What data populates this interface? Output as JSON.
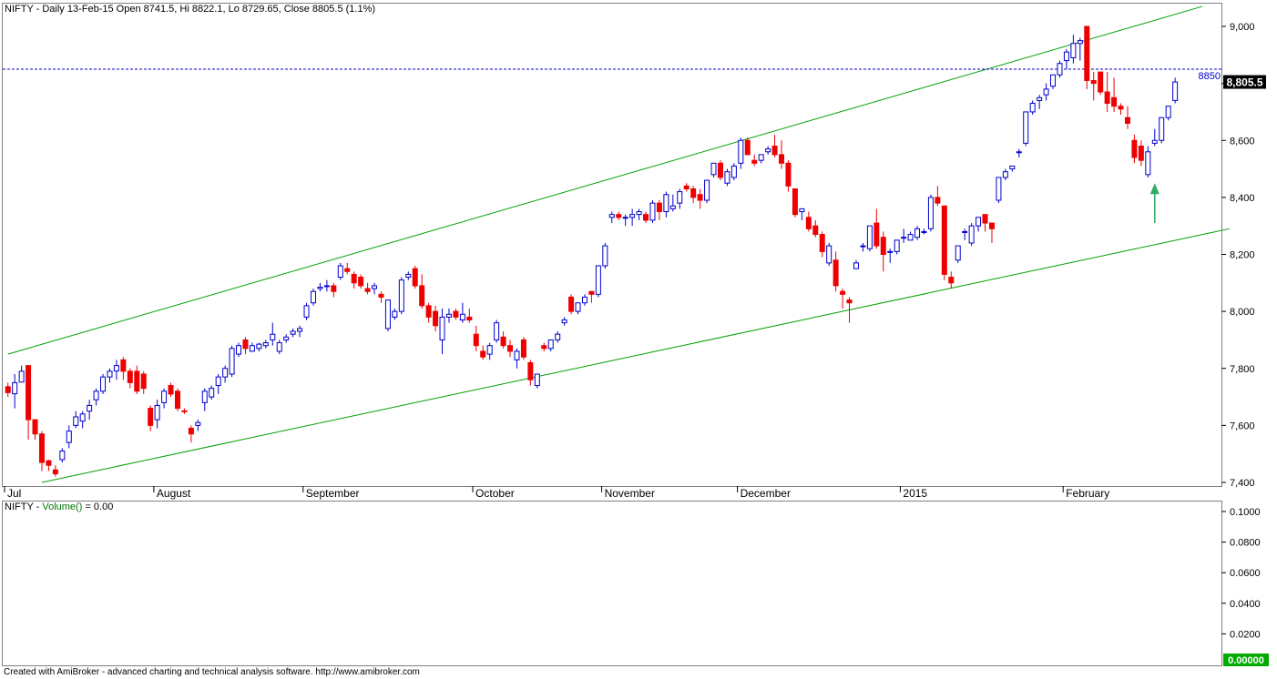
{
  "price_panel": {
    "header": "NIFTY - Daily 13-Feb-15 Open 8741.5, Hi 8822.1, Lo 8729.65, Close 8805.5 (1.1%)",
    "last_price_label": "8,805.5",
    "ref_line_label": "8850"
  },
  "volume_panel": {
    "header_prefix": "NIFTY - ",
    "header_indicator": "Volume()",
    "header_suffix": " = 0.00",
    "last_value_label": "0.00000"
  },
  "footer": "Created with AmiBroker - advanced charting and technical analysis software. http://www.amibroker.com",
  "colors": {
    "up_body": "#ffffff",
    "up_border": "#0000cc",
    "down_body": "#ee0000",
    "channel": "#00a000",
    "ref_line": "#0000cc",
    "arrow": "#33aa66",
    "volume_label": "#007700",
    "last_price_bg": "#000000",
    "last_volume_bg": "#00aa00"
  },
  "chart_data": [
    {
      "type": "candlestick",
      "name": "NIFTY",
      "x_labels": [
        "Jul",
        "August",
        "September",
        "October",
        "November",
        "December",
        "2015",
        "February"
      ],
      "y_ticks": [
        "7,400",
        "7,600",
        "7,800",
        "8,000",
        "8,200",
        "8,400",
        "8,600",
        "8,800",
        "9,000"
      ],
      "ylim": [
        7400,
        9000
      ],
      "reference_line": 8850,
      "channel_upper": [
        [
          0,
          7850
        ],
        [
          176,
          9070
        ]
      ],
      "channel_lower": [
        [
          5,
          7400
        ],
        [
          180,
          8290
        ]
      ],
      "annotation": {
        "type": "up-arrow",
        "at_bar": 169,
        "price_from": 8310,
        "price_to": 8450
      },
      "candles": [
        [
          7736,
          7750,
          7700,
          7715
        ],
        [
          7711,
          7780,
          7660,
          7750
        ],
        [
          7752,
          7810,
          7760,
          7790
        ],
        [
          7810,
          7810,
          7550,
          7620
        ],
        [
          7620,
          7620,
          7550,
          7570
        ],
        [
          7570,
          7580,
          7440,
          7470
        ],
        [
          7476,
          7480,
          7440,
          7460
        ],
        [
          7444,
          7460,
          7420,
          7430
        ],
        [
          7480,
          7520,
          7470,
          7510
        ],
        [
          7540,
          7600,
          7520,
          7580
        ],
        [
          7600,
          7650,
          7590,
          7630
        ],
        [
          7615,
          7650,
          7590,
          7640
        ],
        [
          7650,
          7690,
          7620,
          7670
        ],
        [
          7690,
          7730,
          7670,
          7720
        ],
        [
          7720,
          7780,
          7710,
          7770
        ],
        [
          7770,
          7800,
          7750,
          7790
        ],
        [
          7791,
          7830,
          7760,
          7810
        ],
        [
          7830,
          7840,
          7760,
          7790
        ],
        [
          7790,
          7800,
          7730,
          7750
        ],
        [
          7790,
          7810,
          7710,
          7720
        ],
        [
          7780,
          7790,
          7710,
          7730
        ],
        [
          7660,
          7670,
          7580,
          7600
        ],
        [
          7620,
          7690,
          7590,
          7670
        ],
        [
          7680,
          7730,
          7660,
          7720
        ],
        [
          7740,
          7750,
          7700,
          7710
        ],
        [
          7720,
          7730,
          7650,
          7660
        ],
        [
          7651,
          7660,
          7640,
          7649
        ],
        [
          7590,
          7600,
          7540,
          7570
        ],
        [
          7600,
          7620,
          7580,
          7610
        ],
        [
          7680,
          7730,
          7650,
          7720
        ],
        [
          7700,
          7740,
          7690,
          7730
        ],
        [
          7740,
          7780,
          7710,
          7770
        ],
        [
          7770,
          7810,
          7750,
          7800
        ],
        [
          7780,
          7880,
          7770,
          7870
        ],
        [
          7850,
          7890,
          7840,
          7880
        ],
        [
          7900,
          7910,
          7850,
          7870
        ],
        [
          7860,
          7890,
          7860,
          7880
        ],
        [
          7870,
          7890,
          7860,
          7885
        ],
        [
          7880,
          7900,
          7870,
          7890
        ],
        [
          7900,
          7960,
          7880,
          7920
        ],
        [
          7860,
          7900,
          7850,
          7890
        ],
        [
          7900,
          7920,
          7890,
          7910
        ],
        [
          7920,
          7940,
          7910,
          7930
        ],
        [
          7930,
          7950,
          7910,
          7940
        ],
        [
          7980,
          8030,
          7970,
          8020
        ],
        [
          8030,
          8080,
          8020,
          8070
        ],
        [
          8080,
          8100,
          8070,
          8085
        ],
        [
          8090,
          8110,
          8070,
          8090
        ],
        [
          8090,
          8100,
          8050,
          8070
        ],
        [
          8120,
          8170,
          8110,
          8160
        ],
        [
          8150,
          8170,
          8130,
          8140
        ],
        [
          8130,
          8140,
          8080,
          8100
        ],
        [
          8120,
          8130,
          8080,
          8090
        ],
        [
          8080,
          8100,
          8060,
          8070
        ],
        [
          8080,
          8100,
          8060,
          8090
        ],
        [
          8060,
          8070,
          8030,
          8050
        ],
        [
          7940,
          8030,
          7930,
          8040
        ],
        [
          7980,
          8010,
          7970,
          8000
        ],
        [
          8000,
          8120,
          7990,
          8110
        ],
        [
          8120,
          8140,
          8110,
          8130
        ],
        [
          8150,
          8160,
          8080,
          8090
        ],
        [
          8090,
          8130,
          8010,
          8020
        ],
        [
          8020,
          8030,
          7960,
          7980
        ],
        [
          8000,
          8020,
          7930,
          7950
        ],
        [
          7900,
          8010,
          7850,
          7980
        ],
        [
          7980,
          8010,
          7960,
          7990
        ],
        [
          8000,
          8010,
          7970,
          7980
        ],
        [
          7970,
          8030,
          7960,
          7990
        ],
        [
          7980,
          8010,
          7960,
          7970
        ],
        [
          7920,
          7950,
          7860,
          7880
        ],
        [
          7860,
          7880,
          7830,
          7840
        ],
        [
          7850,
          7890,
          7830,
          7880
        ],
        [
          7900,
          7970,
          7890,
          7960
        ],
        [
          7910,
          7930,
          7870,
          7880
        ],
        [
          7880,
          7900,
          7840,
          7860
        ],
        [
          7830,
          7870,
          7800,
          7860
        ],
        [
          7900,
          7910,
          7830,
          7840
        ],
        [
          7820,
          7830,
          7740,
          7760
        ],
        [
          7740,
          7780,
          7730,
          7780
        ],
        [
          7880,
          7890,
          7860,
          7870
        ],
        [
          7870,
          7900,
          7860,
          7900
        ],
        [
          7900,
          7930,
          7890,
          7920
        ],
        [
          7960,
          7980,
          7950,
          7970
        ],
        [
          8050,
          8060,
          7990,
          8000
        ],
        [
          8000,
          8030,
          7990,
          8030
        ],
        [
          8030,
          8060,
          8020,
          8050
        ],
        [
          8070,
          8070,
          8030,
          8060
        ],
        [
          8060,
          8160,
          8050,
          8160
        ],
        [
          8160,
          8240,
          8150,
          8230
        ],
        [
          8330,
          8350,
          8310,
          8340
        ],
        [
          8340,
          8350,
          8320,
          8330
        ],
        [
          8330,
          8340,
          8300,
          8330
        ],
        [
          8330,
          8360,
          8300,
          8340
        ],
        [
          8340,
          8360,
          8320,
          8350
        ],
        [
          8340,
          8350,
          8310,
          8320
        ],
        [
          8320,
          8390,
          8310,
          8380
        ],
        [
          8380,
          8390,
          8320,
          8350
        ],
        [
          8350,
          8420,
          8330,
          8410
        ],
        [
          8360,
          8410,
          8350,
          8370
        ],
        [
          8380,
          8430,
          8360,
          8420
        ],
        [
          8440,
          8450,
          8420,
          8430
        ],
        [
          8430,
          8440,
          8380,
          8400
        ],
        [
          8410,
          8430,
          8360,
          8390
        ],
        [
          8390,
          8460,
          8380,
          8460
        ],
        [
          8480,
          8520,
          8470,
          8520
        ],
        [
          8520,
          8530,
          8460,
          8470
        ],
        [
          8450,
          8500,
          8440,
          8490
        ],
        [
          8470,
          8520,
          8460,
          8510
        ],
        [
          8520,
          8610,
          8500,
          8600
        ],
        [
          8600,
          8610,
          8550,
          8550
        ],
        [
          8530,
          8550,
          8510,
          8520
        ],
        [
          8530,
          8550,
          8520,
          8550
        ],
        [
          8560,
          8580,
          8550,
          8570
        ],
        [
          8580,
          8620,
          8540,
          8550
        ],
        [
          8550,
          8600,
          8500,
          8520
        ],
        [
          8520,
          8530,
          8420,
          8440
        ],
        [
          8430,
          8430,
          8330,
          8340
        ],
        [
          8350,
          8360,
          8320,
          8360
        ],
        [
          8330,
          8350,
          8280,
          8290
        ],
        [
          8300,
          8320,
          8260,
          8270
        ],
        [
          8270,
          8280,
          8190,
          8210
        ],
        [
          8170,
          8240,
          8160,
          8230
        ],
        [
          8180,
          8210,
          8070,
          8090
        ],
        [
          8070,
          8080,
          8010,
          8060
        ],
        [
          8040,
          8050,
          7960,
          8030
        ],
        [
          8150,
          8180,
          8150,
          8170
        ],
        [
          8230,
          8240,
          8210,
          8230
        ],
        [
          8220,
          8300,
          8210,
          8300
        ],
        [
          8310,
          8360,
          8220,
          8230
        ],
        [
          8260,
          8280,
          8140,
          8200
        ],
        [
          8210,
          8220,
          8170,
          8210
        ],
        [
          8210,
          8250,
          8200,
          8250
        ],
        [
          8260,
          8290,
          8240,
          8260
        ],
        [
          8250,
          8280,
          8250,
          8270
        ],
        [
          8260,
          8300,
          8250,
          8290
        ],
        [
          8280,
          8290,
          8270,
          8280
        ],
        [
          8290,
          8410,
          8280,
          8400
        ],
        [
          8400,
          8440,
          8370,
          8380
        ],
        [
          8370,
          8370,
          8110,
          8130
        ],
        [
          8120,
          8140,
          8080,
          8100
        ],
        [
          8180,
          8230,
          8170,
          8230
        ],
        [
          8280,
          8290,
          8250,
          8280
        ],
        [
          8240,
          8310,
          8230,
          8300
        ],
        [
          8300,
          8330,
          8280,
          8330
        ],
        [
          8340,
          8340,
          8280,
          8310
        ],
        [
          8310,
          8310,
          8240,
          8290
        ],
        [
          8390,
          8470,
          8380,
          8470
        ],
        [
          8470,
          8500,
          8460,
          8490
        ],
        [
          8500,
          8510,
          8490,
          8510
        ],
        [
          8560,
          8570,
          8540,
          8560
        ],
        [
          8590,
          8700,
          8580,
          8700
        ],
        [
          8700,
          8740,
          8690,
          8730
        ],
        [
          8740,
          8760,
          8710,
          8750
        ],
        [
          8760,
          8800,
          8740,
          8780
        ],
        [
          8790,
          8830,
          8780,
          8830
        ],
        [
          8830,
          8880,
          8820,
          8870
        ],
        [
          8880,
          8920,
          8850,
          8910
        ],
        [
          8890,
          8970,
          8870,
          8940
        ],
        [
          8940,
          8960,
          8880,
          8950
        ],
        [
          9000,
          9000,
          8780,
          8810
        ],
        [
          8810,
          8840,
          8740,
          8800
        ],
        [
          8840,
          8840,
          8760,
          8770
        ],
        [
          8770,
          8840,
          8700,
          8730
        ],
        [
          8750,
          8820,
          8700,
          8720
        ],
        [
          8720,
          8730,
          8690,
          8710
        ],
        [
          8680,
          8720,
          8640,
          8660
        ],
        [
          8600,
          8620,
          8520,
          8540
        ],
        [
          8580,
          8600,
          8510,
          8530
        ],
        [
          8480,
          8580,
          8470,
          8560
        ],
        [
          8590,
          8640,
          8580,
          8600
        ],
        [
          8600,
          8680,
          8590,
          8680
        ],
        [
          8680,
          8720,
          8670,
          8720
        ],
        [
          8740,
          8820,
          8730,
          8805
        ]
      ]
    },
    {
      "type": "line",
      "name": "Volume()",
      "y_ticks": [
        "0.1000",
        "0.0800",
        "0.0600",
        "0.0400",
        "0.0200"
      ],
      "ylim": [
        0,
        0.11
      ],
      "last_value": 0.0
    }
  ]
}
